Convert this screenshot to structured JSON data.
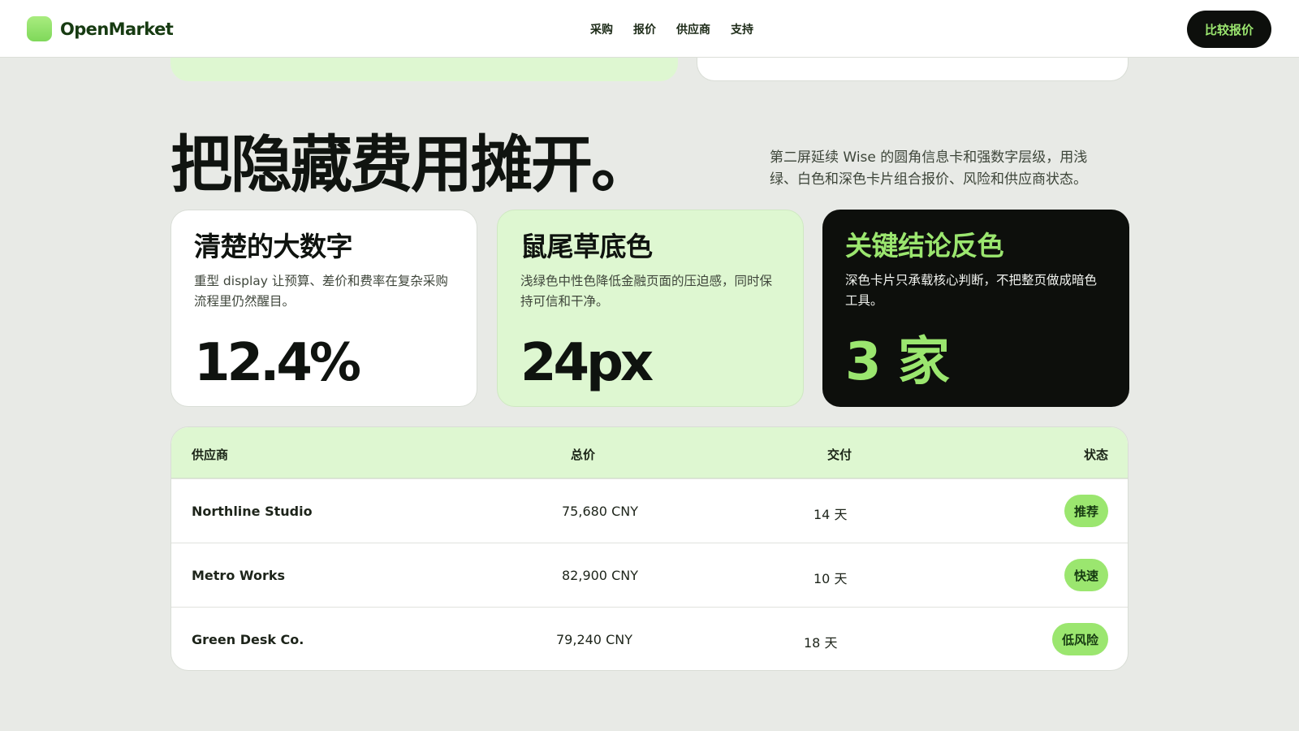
{
  "header": {
    "brand": "OpenMarket",
    "nav": [
      "采购",
      "报价",
      "供应商",
      "支持"
    ],
    "cta_label": "比较报价"
  },
  "hero": {
    "title": "把隐藏费用摊开。",
    "description": "第二屏延续 Wise 的圆角信息卡和强数字层级，用浅绿、白色和深色卡片组合报价、风险和供应商状态。"
  },
  "stats": [
    {
      "title": "清楚的大数字",
      "desc": "重型 display 让预算、差价和费率在复杂采购流程里仍然醒目。",
      "value": "12.4%"
    },
    {
      "title": "鼠尾草底色",
      "desc": "浅绿色中性色降低金融页面的压迫感，同时保持可信和干净。",
      "value": "24px"
    },
    {
      "title": "关键结论反色",
      "desc": "深色卡片只承载核心判断，不把整页做成暗色工具。",
      "value": "3 家"
    }
  ],
  "table": {
    "headers": [
      "供应商",
      "总价",
      "交付",
      "状态"
    ],
    "rows": [
      {
        "supplier": "Northline Studio",
        "total": "75,680 CNY",
        "delivery": "14 天",
        "status": "推荐"
      },
      {
        "supplier": "Metro Works",
        "total": "82,900 CNY",
        "delivery": "10 天",
        "status": "快速"
      },
      {
        "supplier": "Green Desk Co.",
        "total": "79,240 CNY",
        "delivery": "18 天",
        "status": "低风险"
      }
    ]
  },
  "colors": {
    "accent": "#9be66f",
    "sage": "#def7d1",
    "dark": "#0d0f0c",
    "background": "#e8eae6"
  }
}
